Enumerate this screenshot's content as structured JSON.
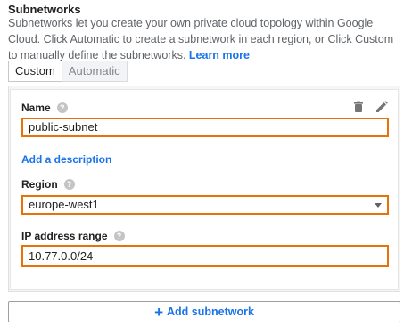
{
  "section": {
    "title": "Subnetworks",
    "description": "Subnetworks let you create your own private cloud topology within Google Cloud. Click Automatic to create a subnetwork in each region, or Click Custom to manually define the subnetworks.",
    "learn_more": "Learn more"
  },
  "tabs": [
    {
      "label": "Custom",
      "selected": true
    },
    {
      "label": "Automatic",
      "selected": false
    }
  ],
  "subnet": {
    "name_label": "Name",
    "name_value": "public-subnet",
    "add_description": "Add a description",
    "region_label": "Region",
    "region_value": "europe-west1",
    "ip_label": "IP address range",
    "ip_value": "10.77.0.0/24",
    "help_icon": "?"
  },
  "actions": {
    "delete_icon": "trash-icon",
    "edit_icon": "pencil-icon",
    "add_label": "Add subnetwork"
  },
  "colors": {
    "accent": "#1a73e8",
    "field_border": "#e8710a"
  }
}
